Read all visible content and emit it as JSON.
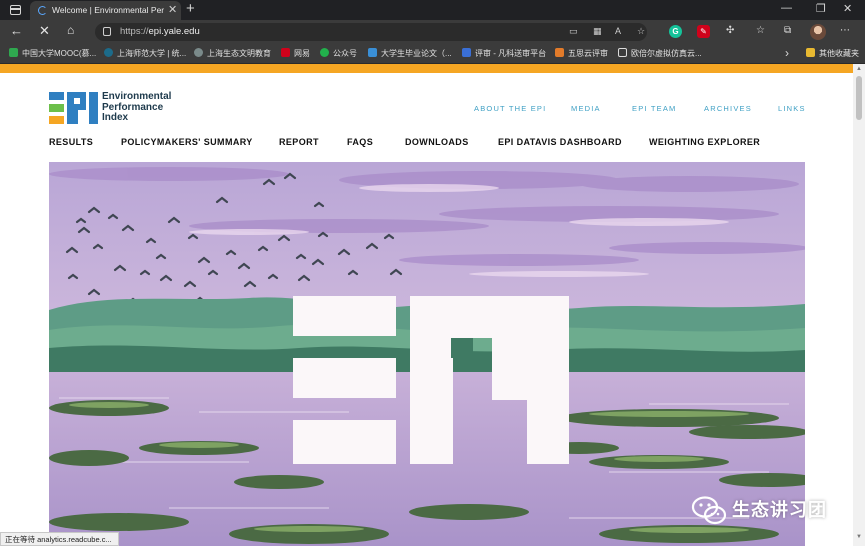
{
  "browser": {
    "tab_title": "Welcome | Environmental Perfor",
    "url_scheme": "https://",
    "url_host": "epi.yale.edu",
    "bookmarks": [
      {
        "label": "中国大学MOOC(慕...",
        "color": "#2fa84f"
      },
      {
        "label": "上海师范大学 | 统...",
        "color": "#1c6b8a"
      },
      {
        "label": "上海生态文明教育",
        "color": "#7a8a8a"
      },
      {
        "label": "网易",
        "color": "#d0021b"
      },
      {
        "label": "公众号",
        "color": "#22b14c"
      },
      {
        "label": "大学生毕业论文（...",
        "color": "#3a8fd6"
      },
      {
        "label": "评审 - 凡科送审平台",
        "color": "#3a6fd6"
      },
      {
        "label": "五思云评审",
        "color": "#e27b2a"
      },
      {
        "label": "欧倍尔虚拟仿真云...",
        "color": "#dcdcdc"
      }
    ],
    "other_bookmarks": "其他收藏夹",
    "status_text": "正在等待 analytics.readcube.c..."
  },
  "site": {
    "logo_line1": "Environmental",
    "logo_line2": "Performance",
    "logo_line3": "Index",
    "top_nav": [
      "ABOUT THE EPI",
      "MEDIA",
      "EPI TEAM",
      "ARCHIVES",
      "LINKS"
    ],
    "main_nav": [
      "RESULTS",
      "POLICYMAKERS' SUMMARY",
      "REPORT",
      "FAQS",
      "DOWNLOADS",
      "EPI DATAVIS DASHBOARD",
      "WEIGHTING EXPLORER"
    ]
  },
  "watermark": {
    "text": "生态讲习团",
    "icon": "wechat-icon"
  },
  "colors": {
    "accent_orange": "#f5a623",
    "nav_link_blue": "#3fa0c4",
    "logo_navy": "#1e3a4c"
  }
}
